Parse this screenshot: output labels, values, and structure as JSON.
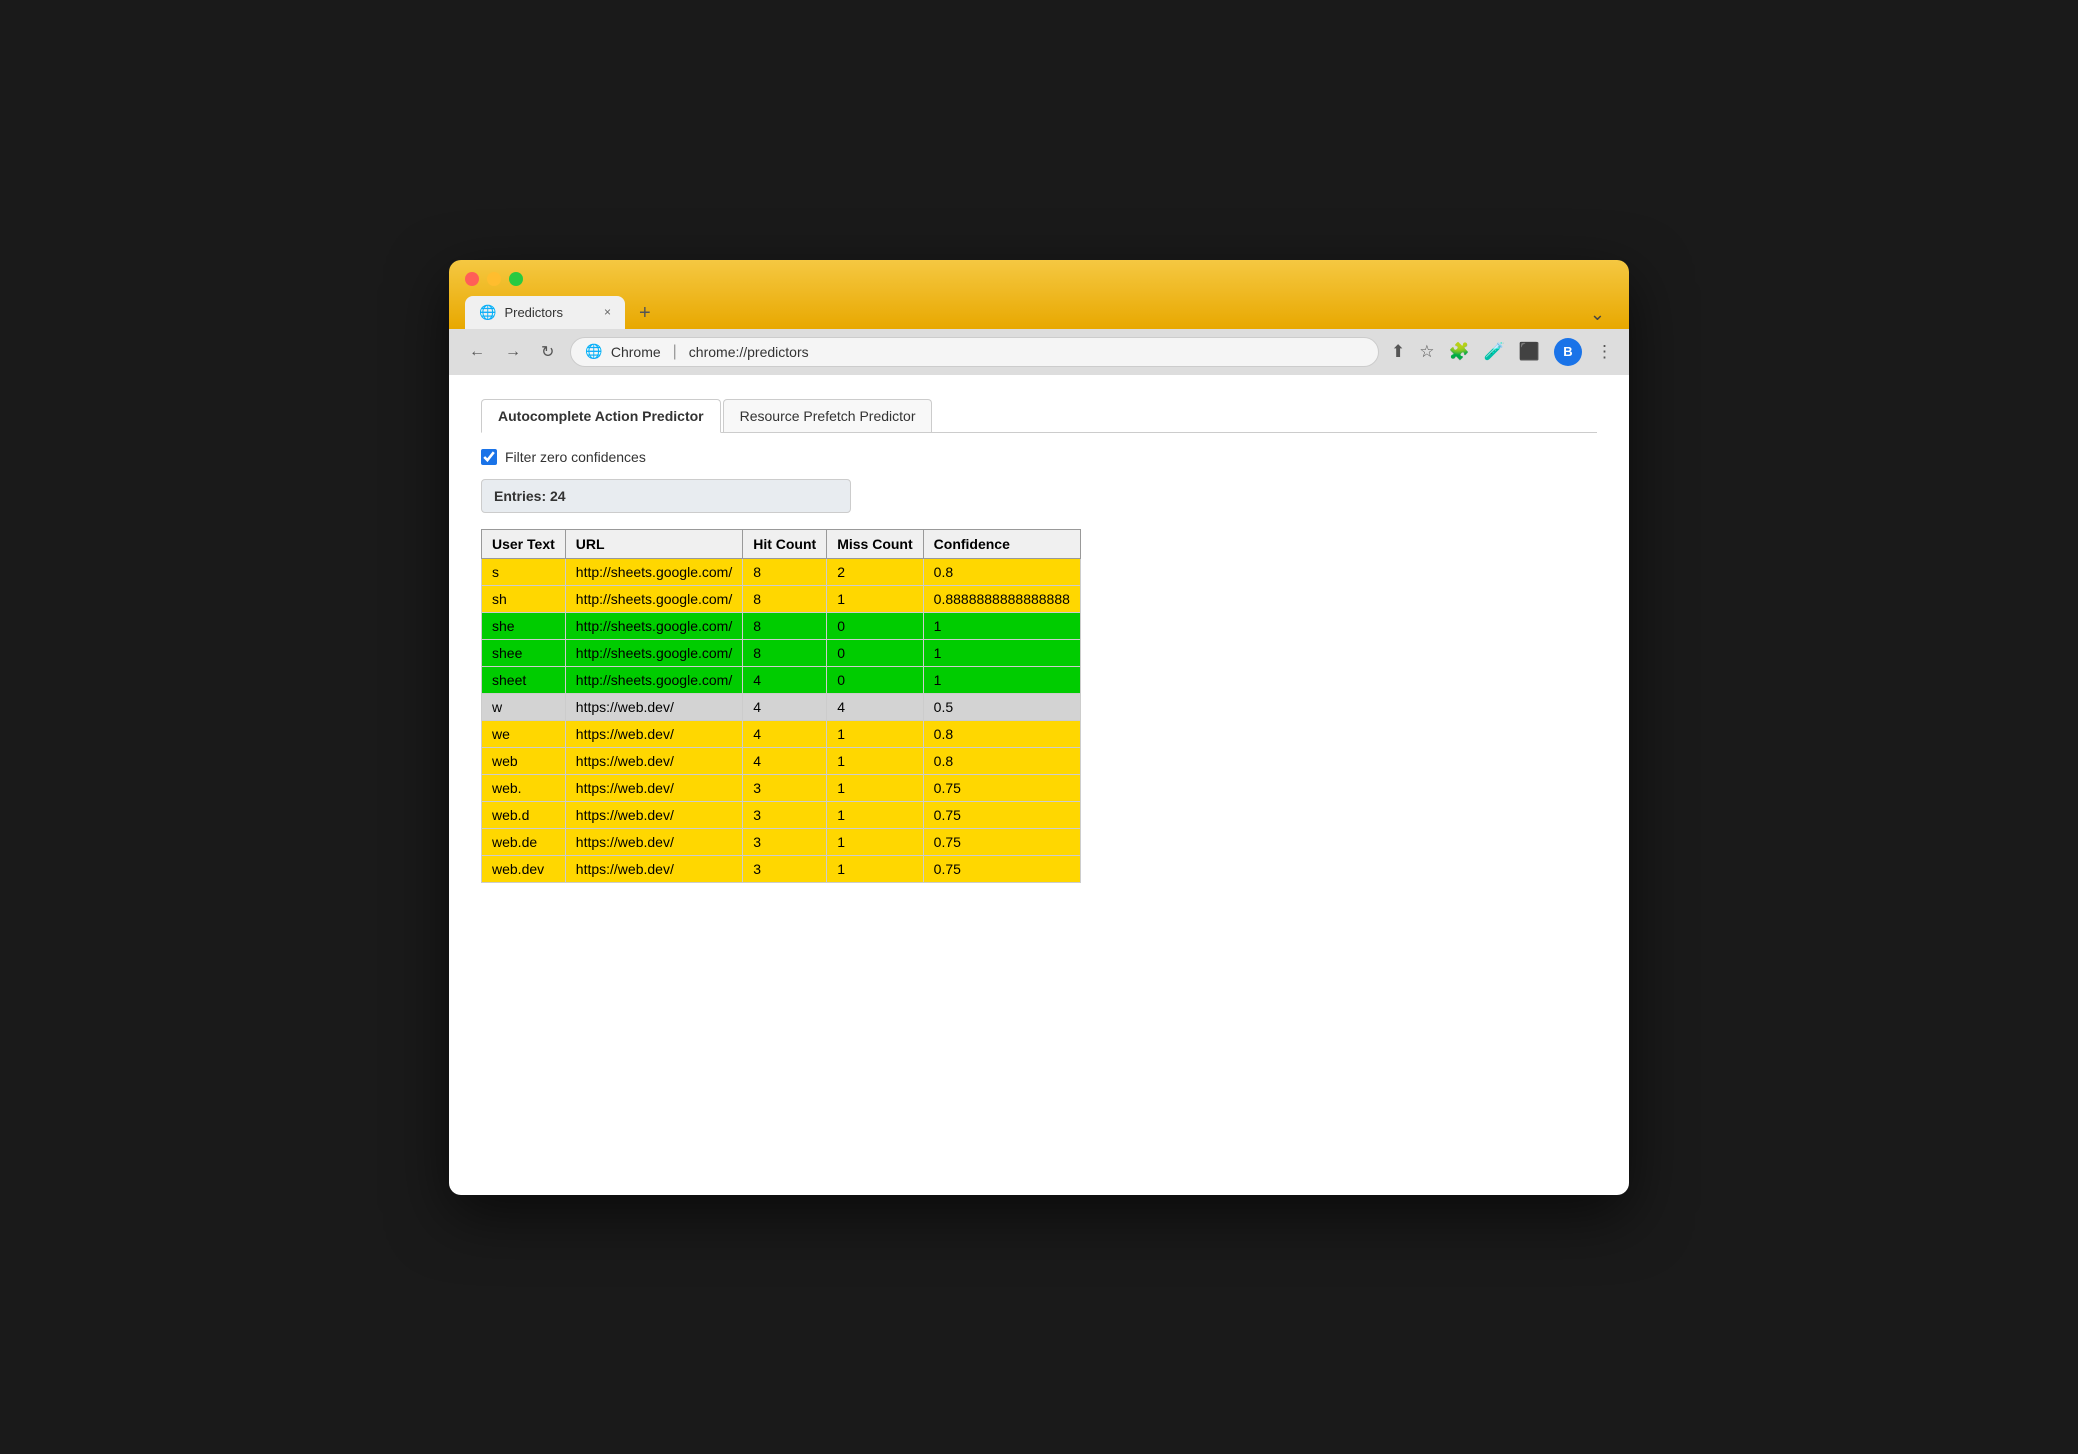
{
  "browser": {
    "tab_title": "Predictors",
    "tab_close": "×",
    "tab_new": "+",
    "tab_menu": "⌄",
    "nav_back": "←",
    "nav_forward": "→",
    "nav_reload": "↻",
    "address_icon": "🌐",
    "address_site": "Chrome",
    "address_separator": "|",
    "address_url": "chrome://predictors",
    "toolbar": {
      "share": "⬆",
      "star": "☆",
      "puzzle": "🧩",
      "lab": "🧪",
      "sidebar": "⬛",
      "more": "⋮"
    },
    "avatar_label": "B"
  },
  "page": {
    "tabs": [
      {
        "label": "Autocomplete Action Predictor",
        "active": true
      },
      {
        "label": "Resource Prefetch Predictor",
        "active": false
      }
    ],
    "filter_label": "Filter zero confidences",
    "filter_checked": true,
    "entries_label": "Entries: 24",
    "table": {
      "headers": [
        "User Text",
        "URL",
        "Hit Count",
        "Miss Count",
        "Confidence"
      ],
      "rows": [
        {
          "user_text": "s",
          "url": "http://sheets.google.com/",
          "hit": "8",
          "miss": "2",
          "confidence": "0.8",
          "color": "yellow"
        },
        {
          "user_text": "sh",
          "url": "http://sheets.google.com/",
          "hit": "8",
          "miss": "1",
          "confidence": "0.8888888888888888",
          "color": "yellow"
        },
        {
          "user_text": "she",
          "url": "http://sheets.google.com/",
          "hit": "8",
          "miss": "0",
          "confidence": "1",
          "color": "green"
        },
        {
          "user_text": "shee",
          "url": "http://sheets.google.com/",
          "hit": "8",
          "miss": "0",
          "confidence": "1",
          "color": "green"
        },
        {
          "user_text": "sheet",
          "url": "http://sheets.google.com/",
          "hit": "4",
          "miss": "0",
          "confidence": "1",
          "color": "green"
        },
        {
          "user_text": "w",
          "url": "https://web.dev/",
          "hit": "4",
          "miss": "4",
          "confidence": "0.5",
          "color": "gray"
        },
        {
          "user_text": "we",
          "url": "https://web.dev/",
          "hit": "4",
          "miss": "1",
          "confidence": "0.8",
          "color": "yellow"
        },
        {
          "user_text": "web",
          "url": "https://web.dev/",
          "hit": "4",
          "miss": "1",
          "confidence": "0.8",
          "color": "yellow"
        },
        {
          "user_text": "web.",
          "url": "https://web.dev/",
          "hit": "3",
          "miss": "1",
          "confidence": "0.75",
          "color": "yellow"
        },
        {
          "user_text": "web.d",
          "url": "https://web.dev/",
          "hit": "3",
          "miss": "1",
          "confidence": "0.75",
          "color": "yellow"
        },
        {
          "user_text": "web.de",
          "url": "https://web.dev/",
          "hit": "3",
          "miss": "1",
          "confidence": "0.75",
          "color": "yellow"
        },
        {
          "user_text": "web.dev",
          "url": "https://web.dev/",
          "hit": "3",
          "miss": "1",
          "confidence": "0.75",
          "color": "yellow"
        }
      ]
    }
  }
}
